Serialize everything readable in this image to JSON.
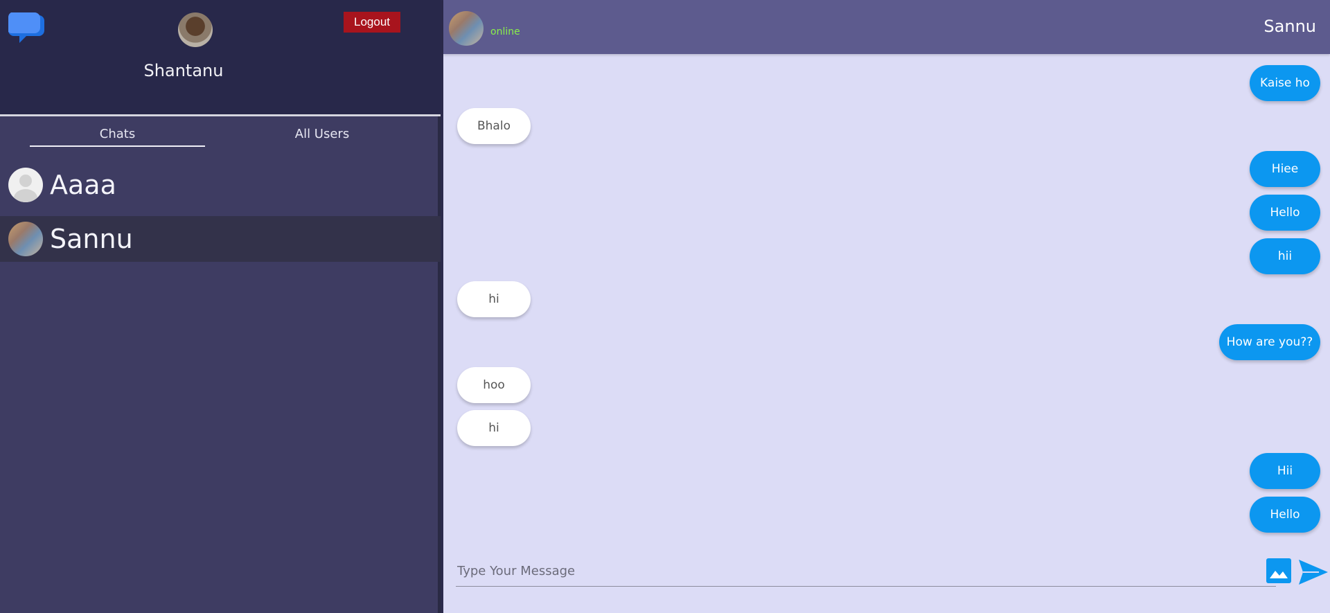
{
  "sidebar": {
    "profile_name": "Shantanu",
    "logout_label": "Logout",
    "tabs": [
      {
        "label": "Chats"
      },
      {
        "label": "All Users"
      }
    ],
    "contacts": [
      {
        "name": "Aaaa"
      },
      {
        "name": "Sannu"
      }
    ]
  },
  "chat": {
    "title": "Sannu",
    "status": "online",
    "messages": [
      {
        "text": "Kaise ho",
        "direction": "out"
      },
      {
        "text": "Bhalo",
        "direction": "in"
      },
      {
        "text": "Hiee",
        "direction": "out"
      },
      {
        "text": "Hello",
        "direction": "out"
      },
      {
        "text": "hii",
        "direction": "out"
      },
      {
        "text": "hi",
        "direction": "in"
      },
      {
        "text": "How are you??",
        "direction": "out"
      },
      {
        "text": "hoo",
        "direction": "in"
      },
      {
        "text": "hi",
        "direction": "in"
      },
      {
        "text": "Hii",
        "direction": "out"
      },
      {
        "text": "Hello",
        "direction": "out"
      }
    ],
    "input_placeholder": "Type Your Message"
  },
  "colors": {
    "sidebar_bg": "#3e3c62",
    "header_bg": "#28284a",
    "chat_bg": "#dcdcf6",
    "chat_header_bg": "#5d5b8e",
    "outgoing_bubble": "#0c97f0",
    "incoming_bubble": "#ffffff",
    "logout_bg": "#a8141d",
    "online": "#8af04a"
  },
  "icons": {
    "app_logo": "chat-bubble-icon",
    "image": "image-icon",
    "send": "send-icon"
  }
}
